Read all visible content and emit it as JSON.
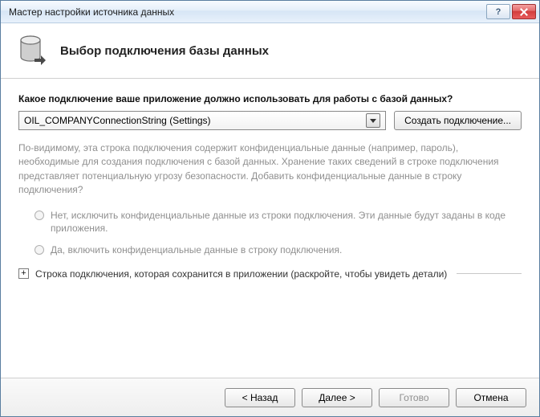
{
  "window": {
    "title": "Мастер настройки источника данных",
    "help_glyph": "?"
  },
  "header": {
    "title": "Выбор подключения базы данных"
  },
  "main": {
    "question": "Какое подключение ваше приложение должно использовать для работы с базой данных?",
    "selected_connection": "OIL_COMPANYConnectionString (Settings)",
    "new_connection_btn": "Создать подключение...",
    "info_paragraph": "По-видимому, эта строка подключения содержит конфиденциальные данные (например, пароль), необходимые для создания подключения с базой данных. Хранение таких сведений в строке подключения представляет потенциальную угрозу безопасности. Добавить конфиденциальные данные в строку подключения?",
    "radio_exclude": "Нет, исключить конфиденциальные данные из строки подключения. Эти данные будут заданы в коде приложения.",
    "radio_include": "Да, включить конфиденциальные данные в строку подключения.",
    "expander_label": "Строка подключения, которая сохранится в приложении (раскройте, чтобы увидеть детали)",
    "expander_glyph": "+"
  },
  "footer": {
    "back": "< Назад",
    "next": "Далее >",
    "finish": "Готово",
    "cancel": "Отмена"
  }
}
